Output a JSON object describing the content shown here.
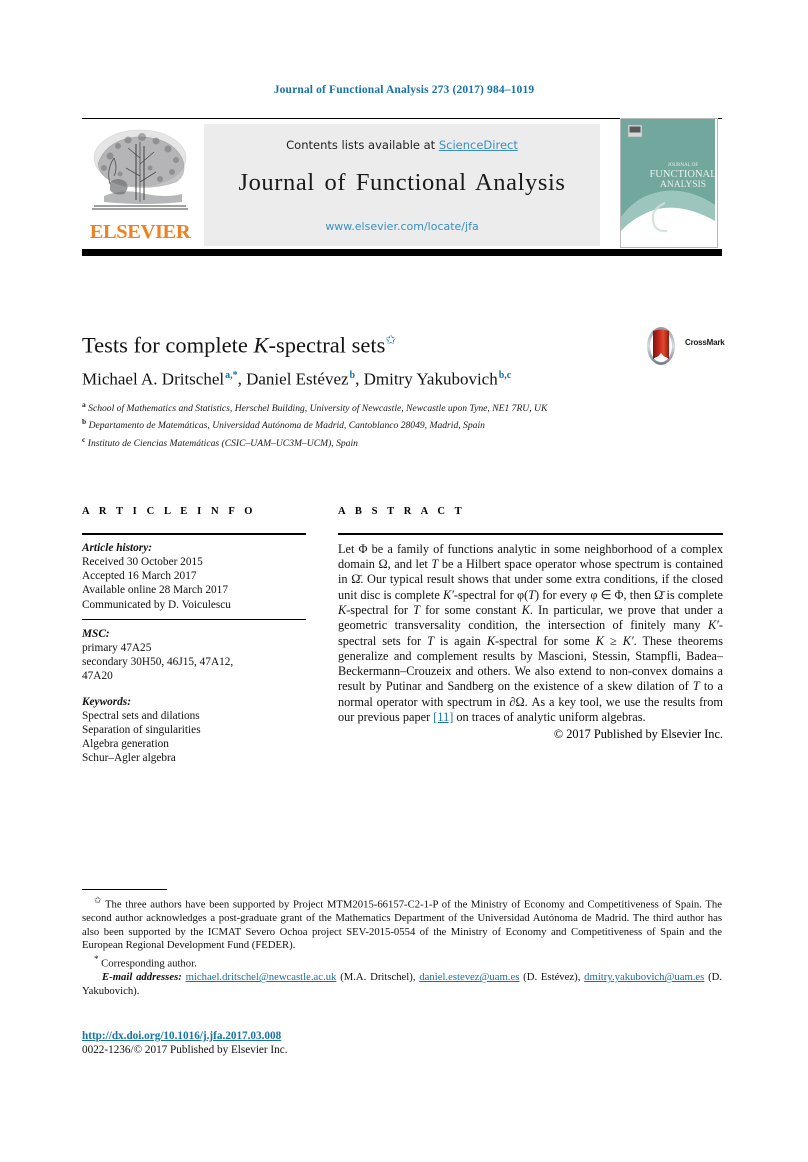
{
  "running_head": "Journal of Functional Analysis 273 (2017) 984–1019",
  "masthead": {
    "contents_prefix": "Contents lists available at ",
    "sciencedirect": "ScienceDirect",
    "journal_name": "Journal of Functional Analysis",
    "journal_url": "www.elsevier.com/locate/jfa",
    "publisher_wordmark": "ELSEVIER",
    "publisher_logo_icon": "elsevier-tree-icon",
    "cover_icon": "journal-cover-thumbnail",
    "cover_title_line1": "JOURNAL OF",
    "cover_title_line2": "FUNCTIONAL",
    "cover_title_line3": "ANALYSIS",
    "link_color": "#3a8fc4",
    "banner_bg": "#ececec",
    "cover_color": "#6fa79b"
  },
  "article": {
    "title_part1": "Tests for complete ",
    "title_italic": "K",
    "title_part2": "-spectral sets",
    "title_footnote_mark": "✩",
    "crossmark_label": "CrossMark",
    "crossmark_icon": "crossmark-logo-icon",
    "authors": [
      {
        "name": "Michael A. Dritschel",
        "marks": "a,*"
      },
      {
        "name": "Daniel Estévez",
        "marks": "b"
      },
      {
        "name": "Dmitry Yakubovich",
        "marks": "b,c"
      }
    ],
    "affiliations": [
      {
        "mark": "a",
        "text": "School of Mathematics and Statistics, Herschel Building, University of Newcastle, Newcastle upon Tyne, NE1 7RU, UK"
      },
      {
        "mark": "b",
        "text": "Departamento de Matemáticas, Universidad Autónoma de Madrid, Cantoblanco 28049, Madrid, Spain"
      },
      {
        "mark": "c",
        "text": "Instituto de Ciencias Matemáticas (CSIC–UAM–UC3M–UCM), Spain"
      }
    ]
  },
  "article_info": {
    "heading": "A R T I C L E  I N F O",
    "history_label": "Article history:",
    "history": [
      "Received 30 October 2015",
      "Accepted 16 March 2017",
      "Available online 28 March 2017",
      "Communicated by D. Voiculescu"
    ],
    "msc_label": "MSC:",
    "msc": [
      "primary 47A25",
      "secondary 30H50, 46J15, 47A12,",
      "47A20"
    ],
    "keywords_label": "Keywords:",
    "keywords": [
      "Spectral sets and dilations",
      "Separation of singularities",
      "Algebra generation",
      "Schur–Agler algebra"
    ]
  },
  "abstract": {
    "heading": "A B S T R A C T",
    "text_p1": "Let Φ be a family of functions analytic in some neighborhood of a complex domain Ω, and let ",
    "text_T1": "T",
    "text_p2": " be a Hilbert space operator whose spectrum is contained in Ω̄. Our typical result shows that under some extra conditions, if the closed unit disc is complete ",
    "text_K1": "K′",
    "text_p3": "-spectral for φ(",
    "text_T2": "T",
    "text_p4": ") for every φ ∈ Φ, then Ω̄ is complete ",
    "text_K2": "K",
    "text_p5": "-spectral for ",
    "text_T3": "T",
    "text_p6": " for some constant ",
    "text_K3": "K",
    "text_p7": ". In particular, we prove that under a geometric transversality condition, the intersection of finitely many ",
    "text_K4": "K′",
    "text_p8": "-spectral sets for ",
    "text_T4": "T",
    "text_p9": " is again ",
    "text_K5": "K",
    "text_p10": "-spectral for some ",
    "text_K6": "K ≥ K′",
    "text_p11": ". These theorems generalize and complement results by Mascioni, Stessin, Stampfli, Badea–Beckermann–Crouzeix and others. We also extend to non-convex domains a result by Putinar and Sandberg on the existence of a skew dilation of ",
    "text_T5": "T",
    "text_p12": " to a normal operator with spectrum in ∂Ω. As a key tool, we use the results from our previous paper ",
    "reference_link": "[11]",
    "text_p13": " on traces of analytic uniform algebras.",
    "copyright": "© 2017 Published by Elsevier Inc."
  },
  "footnotes": {
    "funding_mark": "✩",
    "funding": "The three authors have been supported by Project MTM2015-66157-C2-1-P of the Ministry of Economy and Competitiveness of Spain. The second author acknowledges a post-graduate grant of the Mathematics Department of the Universidad Autónoma de Madrid. The third author has also been supported by the ICMAT Severo Ochoa project SEV-2015-0554 of the Ministry of Economy and Competitiveness of Spain and the European Regional Development Fund (FEDER).",
    "corresponding_mark": "*",
    "corresponding": "Corresponding author.",
    "email_label": "E-mail addresses:",
    "emails": [
      {
        "address": "michael.dritschel@newcastle.ac.uk",
        "owner": "(M.A. Dritschel),"
      },
      {
        "address": "daniel.estevez@uam.es",
        "owner": "(D. Estévez),"
      },
      {
        "address": "dmitry.yakubovich@uam.es",
        "owner": "(D. Yakubovich)."
      }
    ]
  },
  "footer": {
    "doi": "http://dx.doi.org/10.1016/j.jfa.2017.03.008",
    "issn_line": "0022-1236/© 2017 Published by Elsevier Inc."
  }
}
